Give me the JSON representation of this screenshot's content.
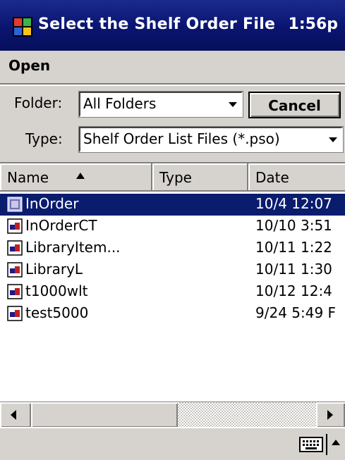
{
  "titlebar": {
    "title": "Select the Shelf Order File",
    "time": "1:56p",
    "logo_icon": "windows-flag-icon"
  },
  "menubar": {
    "open_label": "Open"
  },
  "folder": {
    "label": "Folder:",
    "value": "All Folders"
  },
  "type": {
    "label": "Type:",
    "value": "Shelf Order List Files (*.pso)"
  },
  "cancel_label": "Cancel",
  "list": {
    "columns": [
      "Name",
      "Type",
      "Date"
    ],
    "sort": "ascending-by-name",
    "rows": [
      {
        "name": "InOrder",
        "type": "",
        "date": "10/4 12:07",
        "icon": "folder-icon",
        "selected": true
      },
      {
        "name": "InOrderCT",
        "type": "",
        "date": "10/10 3:51",
        "icon": "file-icon"
      },
      {
        "name": "LibraryItem...",
        "type": "",
        "date": "10/11 1:22",
        "icon": "file-icon"
      },
      {
        "name": "LibraryL",
        "type": "",
        "date": "10/11 1:30",
        "icon": "file-icon"
      },
      {
        "name": "t1000wlt",
        "type": "",
        "date": "10/12 12:4",
        "icon": "file-icon"
      },
      {
        "name": "test5000",
        "type": "",
        "date": "9/24 5:49 F",
        "icon": "file-icon"
      }
    ]
  },
  "scrollbar": {
    "position_fraction": 0.0
  },
  "colors": {
    "title_bg": "#0a1470",
    "selection_bg": "#0a1c6e",
    "chrome_gray": "#d6d3ce"
  },
  "sip": {
    "keyboard_icon": "keyboard-icon",
    "arrow_icon": "caret-up-icon"
  }
}
